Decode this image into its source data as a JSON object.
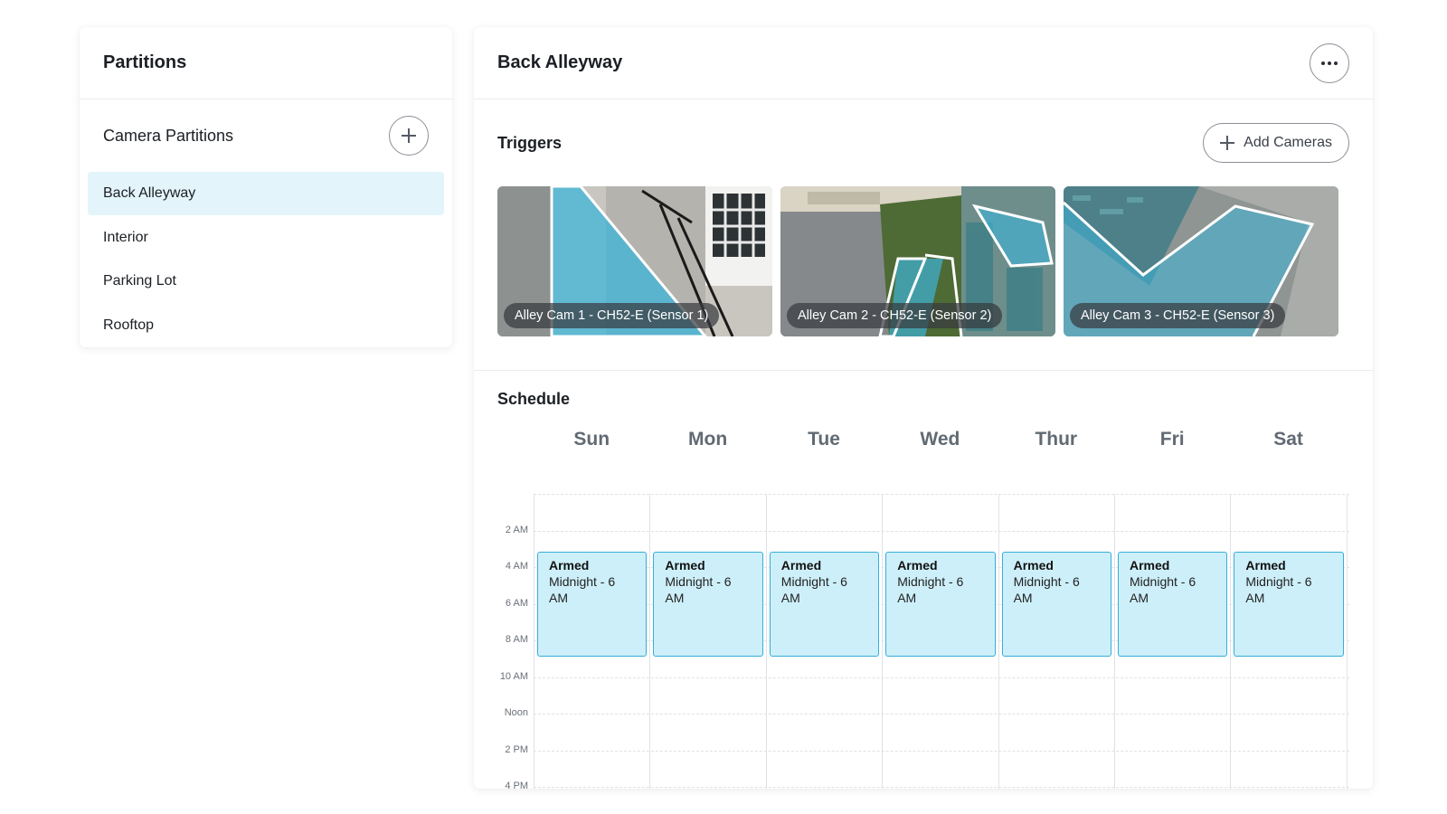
{
  "left_panel": {
    "title": "Partitions",
    "section_title": "Camera Partitions",
    "partitions": [
      {
        "label": "Back Alleyway",
        "active": true
      },
      {
        "label": "Interior",
        "active": false
      },
      {
        "label": "Parking Lot",
        "active": false
      },
      {
        "label": "Rooftop",
        "active": false
      }
    ]
  },
  "right_panel": {
    "title": "Back Alleyway",
    "triggers": {
      "title": "Triggers",
      "add_button_label": "Add Cameras",
      "cameras": [
        {
          "label": "Alley Cam 1 - CH52-E (Sensor 1)"
        },
        {
          "label": "Alley Cam 2 - CH52-E (Sensor 2)"
        },
        {
          "label": "Alley Cam 3 - CH52-E (Sensor 3)"
        }
      ]
    },
    "schedule": {
      "title": "Schedule",
      "days": [
        "Sun",
        "Mon",
        "Tue",
        "Wed",
        "Thur",
        "Fri",
        "Sat"
      ],
      "time_labels": [
        "2 AM",
        "4 AM",
        "6 AM",
        "8 AM",
        "10 AM",
        "Noon",
        "2 PM",
        "4 PM"
      ],
      "events": [
        {
          "status": "Armed",
          "time": "Midnight - 6 AM"
        },
        {
          "status": "Armed",
          "time": "Midnight - 6 AM"
        },
        {
          "status": "Armed",
          "time": "Midnight - 6 AM"
        },
        {
          "status": "Armed",
          "time": "Midnight - 6 AM"
        },
        {
          "status": "Armed",
          "time": "Midnight - 6 AM"
        },
        {
          "status": "Armed",
          "time": "Midnight - 6 AM"
        },
        {
          "status": "Armed",
          "time": "Midnight - 6 AM"
        }
      ]
    }
  },
  "colors": {
    "accent": "#36aed9",
    "event_fill": "#cdeff9",
    "active_item": "#e3f4fb",
    "zone_overlay": "#3eb4d8"
  },
  "icons": {
    "add_partition": "plus-icon",
    "more": "more-horizontal-icon",
    "add_cameras": "plus-icon"
  }
}
